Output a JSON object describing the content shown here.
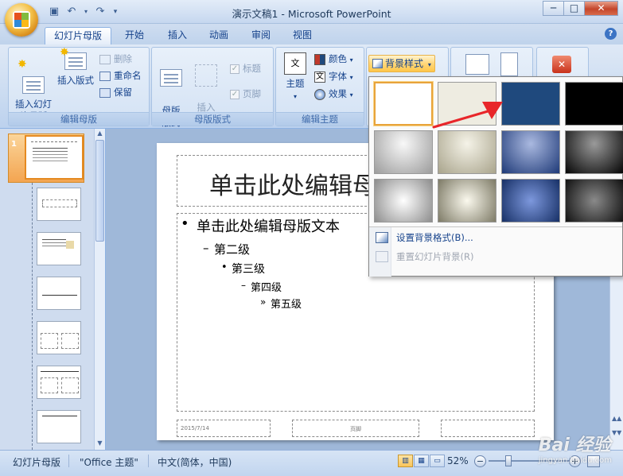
{
  "window": {
    "title": "演示文稿1 - Microsoft PowerPoint",
    "controls": {
      "minimize": "─",
      "maximize": "□",
      "close": "✕"
    }
  },
  "tabs": [
    {
      "label": "幻灯片母版",
      "active": true
    },
    {
      "label": "开始"
    },
    {
      "label": "插入"
    },
    {
      "label": "动画"
    },
    {
      "label": "审阅"
    },
    {
      "label": "视图"
    }
  ],
  "ribbon": {
    "edit_master": {
      "label": "编辑母版",
      "insert_slide_master": "插入幻灯\n片母版",
      "insert_layout": "插入版式",
      "delete": "删除",
      "rename": "重命名",
      "preserve": "保留"
    },
    "master_layout": {
      "label": "母版版式",
      "master_layout_btn": "母版\n版式",
      "insert_placeholder": "插入\n占位符",
      "title_chk": "标题",
      "footer_chk": "页脚"
    },
    "edit_theme": {
      "label": "编辑主题",
      "themes": "主题",
      "colors": "颜色",
      "fonts": "字体",
      "effects": "效果"
    },
    "background": {
      "bg_styles": "背景样式"
    }
  },
  "background_menu": {
    "swatches": [
      {
        "name": "style-1",
        "color": "#ffffff"
      },
      {
        "name": "style-2",
        "color": "#eeece1"
      },
      {
        "name": "style-3",
        "color": "#1f497d"
      },
      {
        "name": "style-4",
        "color": "#000000"
      }
    ],
    "format_background": "设置背景格式(B)...",
    "reset_background": "重置幻灯片背景(R)"
  },
  "slide": {
    "title": "单击此处编辑母",
    "levels": [
      "单击此处编辑母版文本",
      "第二级",
      "第三级",
      "第四级",
      "第五级"
    ],
    "bullets": [
      "•",
      "–",
      "•",
      "–",
      "»"
    ],
    "footer_date": "2015/7/14",
    "footer_text": "页脚"
  },
  "thumbnails": {
    "first_number": "1"
  },
  "status": {
    "view": "幻灯片母版",
    "theme": "\"Office 主题\"",
    "language": "中文(简体，中国)",
    "zoom": "52%"
  },
  "watermark": {
    "brand": "Bai 经验",
    "url": "jingyan.baidu.com"
  }
}
